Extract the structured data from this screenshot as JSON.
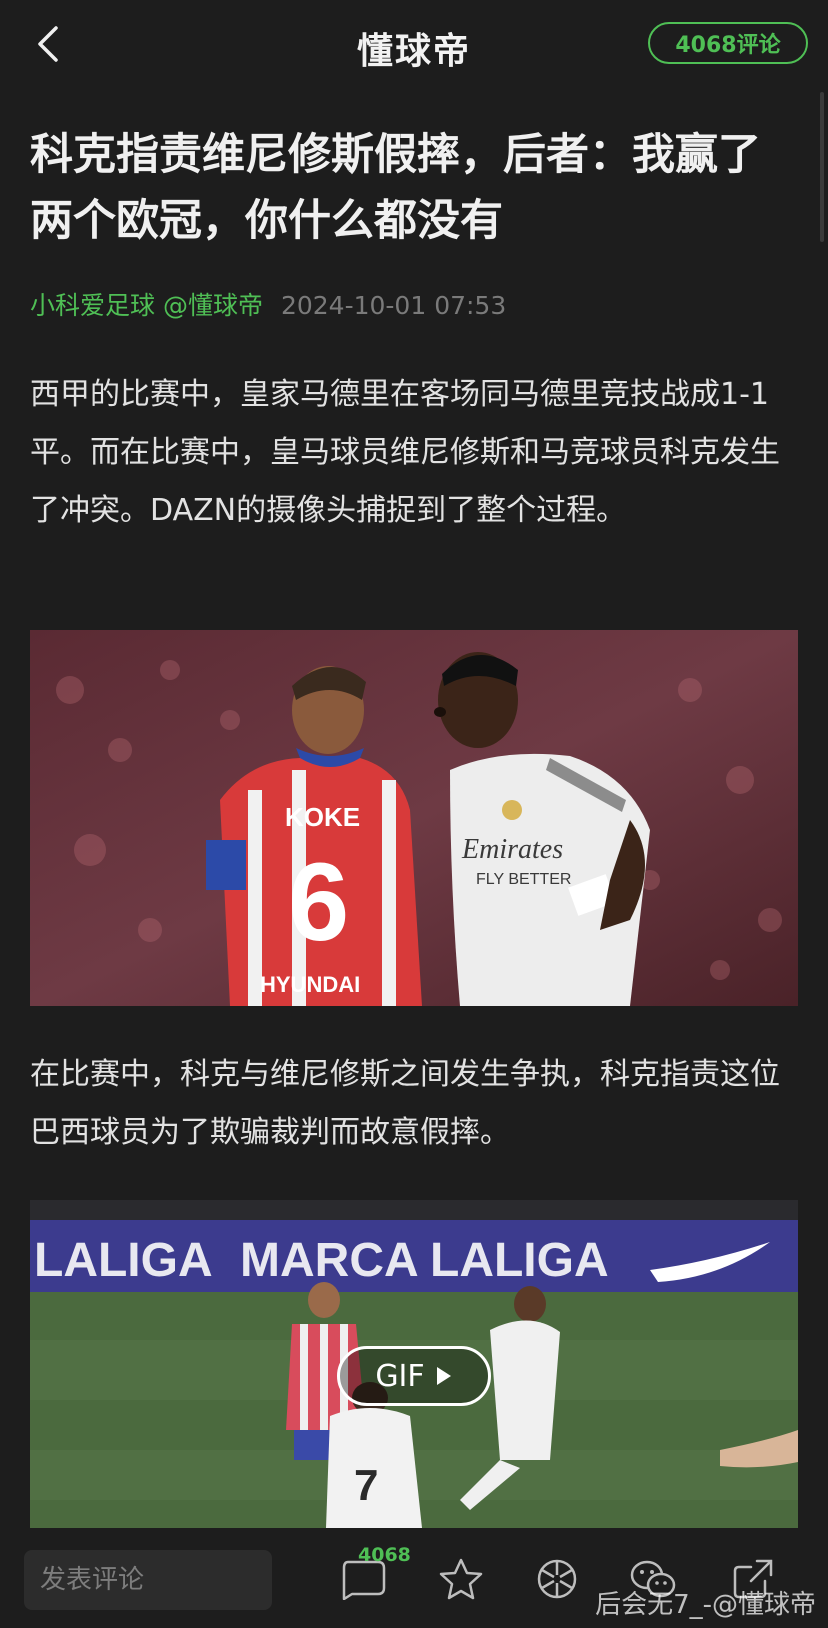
{
  "header": {
    "back_icon": "chevron-left-icon",
    "logo_text": "懂球帝",
    "comment_button": "4068评论",
    "accent_color": "#4fbf55"
  },
  "article": {
    "title": "科克指责维尼修斯假摔，后者：我赢了两个欧冠，你什么都没有",
    "author": "小科爱足球 @懂球帝",
    "timestamp": "2024-10-01 07:53",
    "paragraphs": [
      "西甲的比赛中，皇家马德里在客场同马德里竞技战成1-1平。而在比赛中，皇马球员维尼修斯和马竞球员科克发生了冲突。DAZN的摄像头捕捉到了整个过程。",
      "在比赛中，科克与维尼修斯之间发生争执，科克指责这位巴西球员为了欺骗裁判而故意假摔。"
    ],
    "photo1": {
      "jersey_name": "KOKE",
      "jersey_number": "6",
      "sponsor": "Emirates",
      "sponsor_line2": "FLY BETTER",
      "shirt_sponsor_red": "HYUNDAI"
    },
    "photo2": {
      "board_texts": [
        "LALIGA",
        "MARCA",
        "LALIGA"
      ],
      "player_number": "7",
      "gif_label": "GIF"
    }
  },
  "bottom_bar": {
    "comment_placeholder": "发表评论",
    "comment_count": "4068",
    "icons": [
      "comment-icon",
      "star-icon",
      "moments-icon",
      "wechat-icon",
      "share-icon"
    ],
    "watermark": "后会无7_-@懂球帝"
  }
}
